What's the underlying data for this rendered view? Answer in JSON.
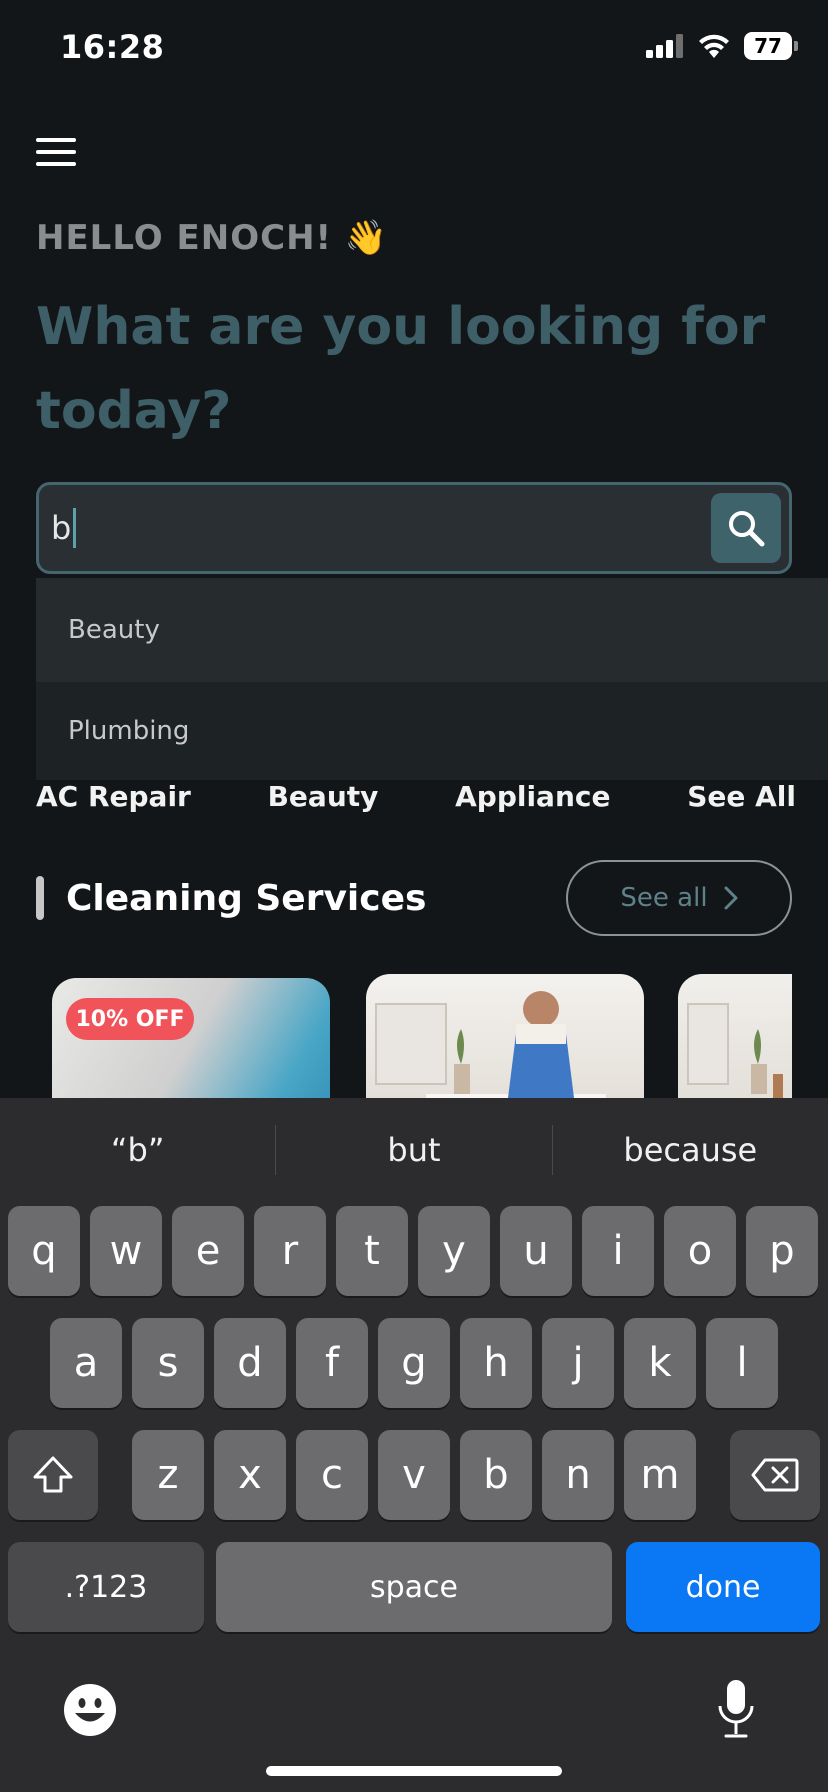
{
  "status": {
    "time": "16:28",
    "battery": "77"
  },
  "greeting": "HELLO ENOCH! 👋",
  "headline": "What are you looking for today?",
  "search": {
    "value": "b"
  },
  "suggestions": [
    "Beauty",
    "Plumbing"
  ],
  "categories": [
    "AC Repair",
    "Beauty",
    "Appliance",
    "See All"
  ],
  "section": {
    "title": "Cleaning Services",
    "see_all": "See all"
  },
  "cards": [
    {
      "badge": "10% OFF"
    }
  ],
  "keyboard": {
    "predictions": [
      "“b”",
      "but",
      "because"
    ],
    "row1": [
      "q",
      "w",
      "e",
      "r",
      "t",
      "y",
      "u",
      "i",
      "o",
      "p"
    ],
    "row2": [
      "a",
      "s",
      "d",
      "f",
      "g",
      "h",
      "j",
      "k",
      "l"
    ],
    "row3": [
      "z",
      "x",
      "c",
      "v",
      "b",
      "n",
      "m"
    ],
    "numbers": ".?123",
    "space": "space",
    "done": "done"
  },
  "colors": {
    "accent": "#3e5f67",
    "done_key": "#0a78f5",
    "badge": "#f0545a",
    "background": "#121618"
  }
}
